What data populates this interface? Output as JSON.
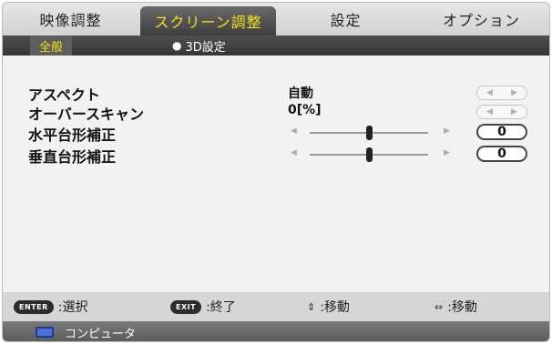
{
  "tabs": [
    {
      "label": "映像調整",
      "active": false
    },
    {
      "label": "スクリーン調整",
      "active": true
    },
    {
      "label": "設定",
      "active": false
    },
    {
      "label": "オプション",
      "active": false
    }
  ],
  "subtabs": [
    {
      "label": "全般",
      "active": true
    },
    {
      "label": "3D設定",
      "active": false
    }
  ],
  "settings": {
    "aspect": {
      "label": "アスペクト",
      "value": "自動",
      "arrow_left": "◀",
      "arrow_right": "▶"
    },
    "overscan": {
      "label": "オーバースキャン",
      "value": "0[%]",
      "arrow_left": "◀",
      "arrow_right": "▶"
    },
    "h_keystone": {
      "label": "水平台形補正",
      "value": "0",
      "level": 0.5,
      "arrow_left": "◀",
      "arrow_right": "▶"
    },
    "v_keystone": {
      "label": "垂直台形補正",
      "value": "0",
      "level": 0.5,
      "arrow_left": "◀",
      "arrow_right": "▶"
    }
  },
  "footer": {
    "enter": {
      "key": "ENTER",
      "label": ":選択"
    },
    "exit": {
      "key": "EXIT",
      "label": ":終了"
    },
    "vertical": {
      "glyph": "⇕",
      "label": ":移動"
    },
    "horizontal": {
      "glyph": "⇔",
      "label": ":移動"
    }
  },
  "source": {
    "label": "コンピュータ",
    "icon": "monitor-icon"
  },
  "colors": {
    "active_text": "#f1e21a",
    "source_icon": "#4d6fd6"
  }
}
